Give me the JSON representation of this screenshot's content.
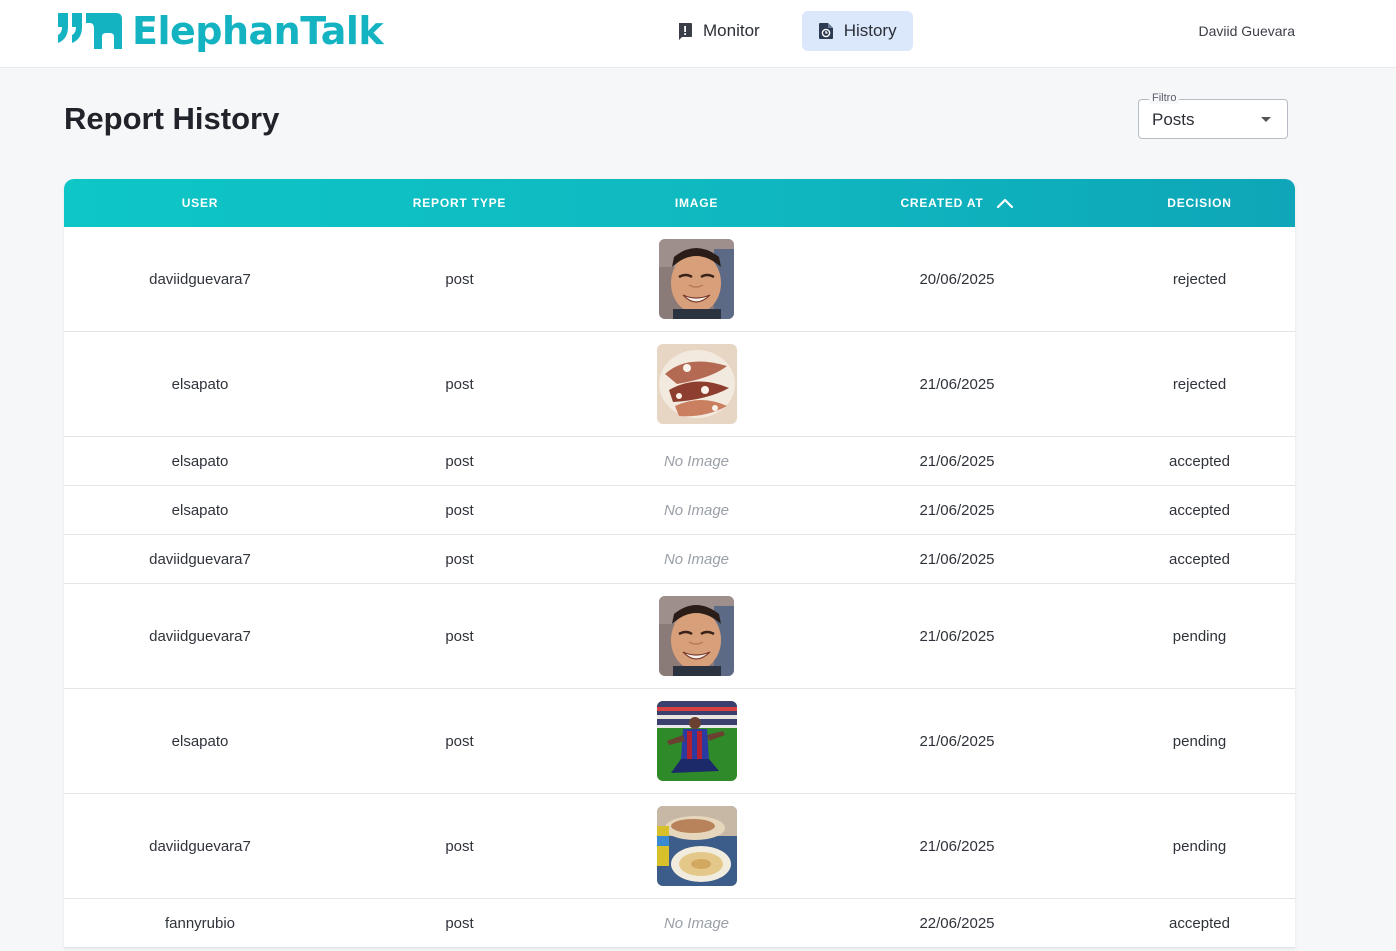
{
  "app": {
    "brand": "ElephanTalk",
    "brand_color": "#14b3c2"
  },
  "nav": {
    "items": [
      {
        "label": "Monitor",
        "icon": "report-alert-icon",
        "active": false
      },
      {
        "label": "History",
        "icon": "history-document-icon",
        "active": true
      }
    ]
  },
  "user": {
    "name": "Daviid Guevara"
  },
  "page": {
    "title": "Report History"
  },
  "filter": {
    "legend": "Filtro",
    "value": "Posts"
  },
  "table": {
    "columns": [
      "USER",
      "REPORT TYPE",
      "IMAGE",
      "CREATED AT",
      "DECISION"
    ],
    "sort": {
      "column": "CREATED AT",
      "direction": "ascending"
    },
    "no_image_label": "No Image",
    "rows": [
      {
        "user": "daviidguevara7",
        "type": "post",
        "image": "photo-man-laughing",
        "created_at": "20/06/2025",
        "decision": "rejected"
      },
      {
        "user": "elsapato",
        "type": "post",
        "image": "photo-grilled-squid",
        "created_at": "21/06/2025",
        "decision": "rejected"
      },
      {
        "user": "elsapato",
        "type": "post",
        "image": null,
        "created_at": "21/06/2025",
        "decision": "accepted"
      },
      {
        "user": "elsapato",
        "type": "post",
        "image": null,
        "created_at": "21/06/2025",
        "decision": "accepted"
      },
      {
        "user": "daviidguevara7",
        "type": "post",
        "image": null,
        "created_at": "21/06/2025",
        "decision": "accepted"
      },
      {
        "user": "daviidguevara7",
        "type": "post",
        "image": "photo-man-laughing",
        "created_at": "21/06/2025",
        "decision": "pending"
      },
      {
        "user": "elsapato",
        "type": "post",
        "image": "photo-soccer-player",
        "created_at": "21/06/2025",
        "decision": "pending"
      },
      {
        "user": "daviidguevara7",
        "type": "post",
        "image": "photo-food-plates",
        "created_at": "21/06/2025",
        "decision": "pending"
      },
      {
        "user": "fannyrubio",
        "type": "post",
        "image": null,
        "created_at": "22/06/2025",
        "decision": "accepted"
      }
    ]
  }
}
